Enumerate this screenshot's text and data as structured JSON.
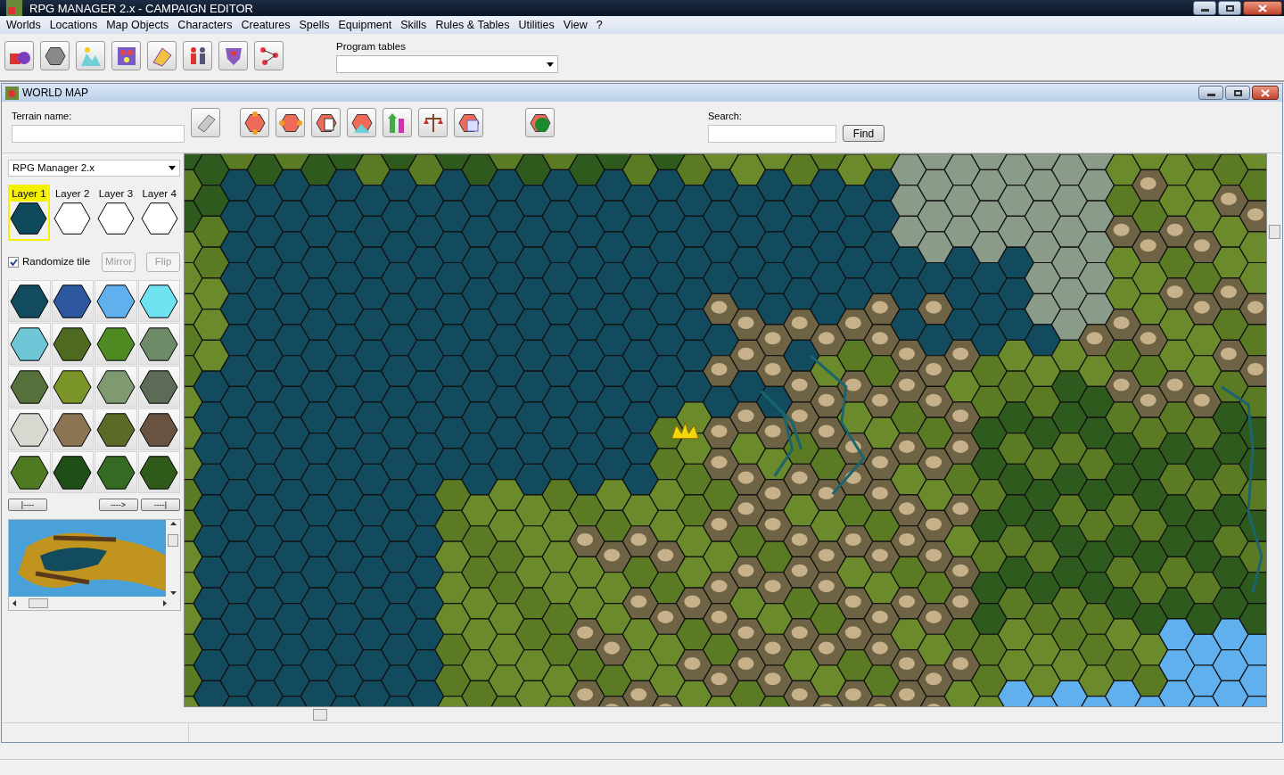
{
  "window": {
    "title": "RPG MANAGER 2.x - CAMPAIGN EDITOR"
  },
  "menu": [
    "Worlds",
    "Locations",
    "Map Objects",
    "Characters",
    "Creatures",
    "Spells",
    "Equipment",
    "Skills",
    "Rules & Tables",
    "Utilities",
    "View",
    "?"
  ],
  "program_tables": {
    "label": "Program tables"
  },
  "child_window": {
    "title": "WORLD MAP"
  },
  "terrain_name": {
    "label": "Terrain name:"
  },
  "search": {
    "label": "Search:",
    "button": "Find"
  },
  "tileset": {
    "value": "RPG Manager 2.x"
  },
  "layers": [
    {
      "label": "Layer 1",
      "selected": true,
      "color": "#0f4a5c"
    },
    {
      "label": "Layer 2",
      "selected": false,
      "color": "#ffffff"
    },
    {
      "label": "Layer 3",
      "selected": false,
      "color": "#ffffff"
    },
    {
      "label": "Layer 4",
      "selected": false,
      "color": "#ffffff"
    }
  ],
  "randomize": {
    "label": "Randomize tile",
    "checked": true
  },
  "tile_buttons": [
    {
      "label": "Mirror",
      "disabled": true
    },
    {
      "label": "Flip",
      "disabled": true
    }
  ],
  "nav_buttons": [
    "|----",
    "---->",
    "----|"
  ]
}
